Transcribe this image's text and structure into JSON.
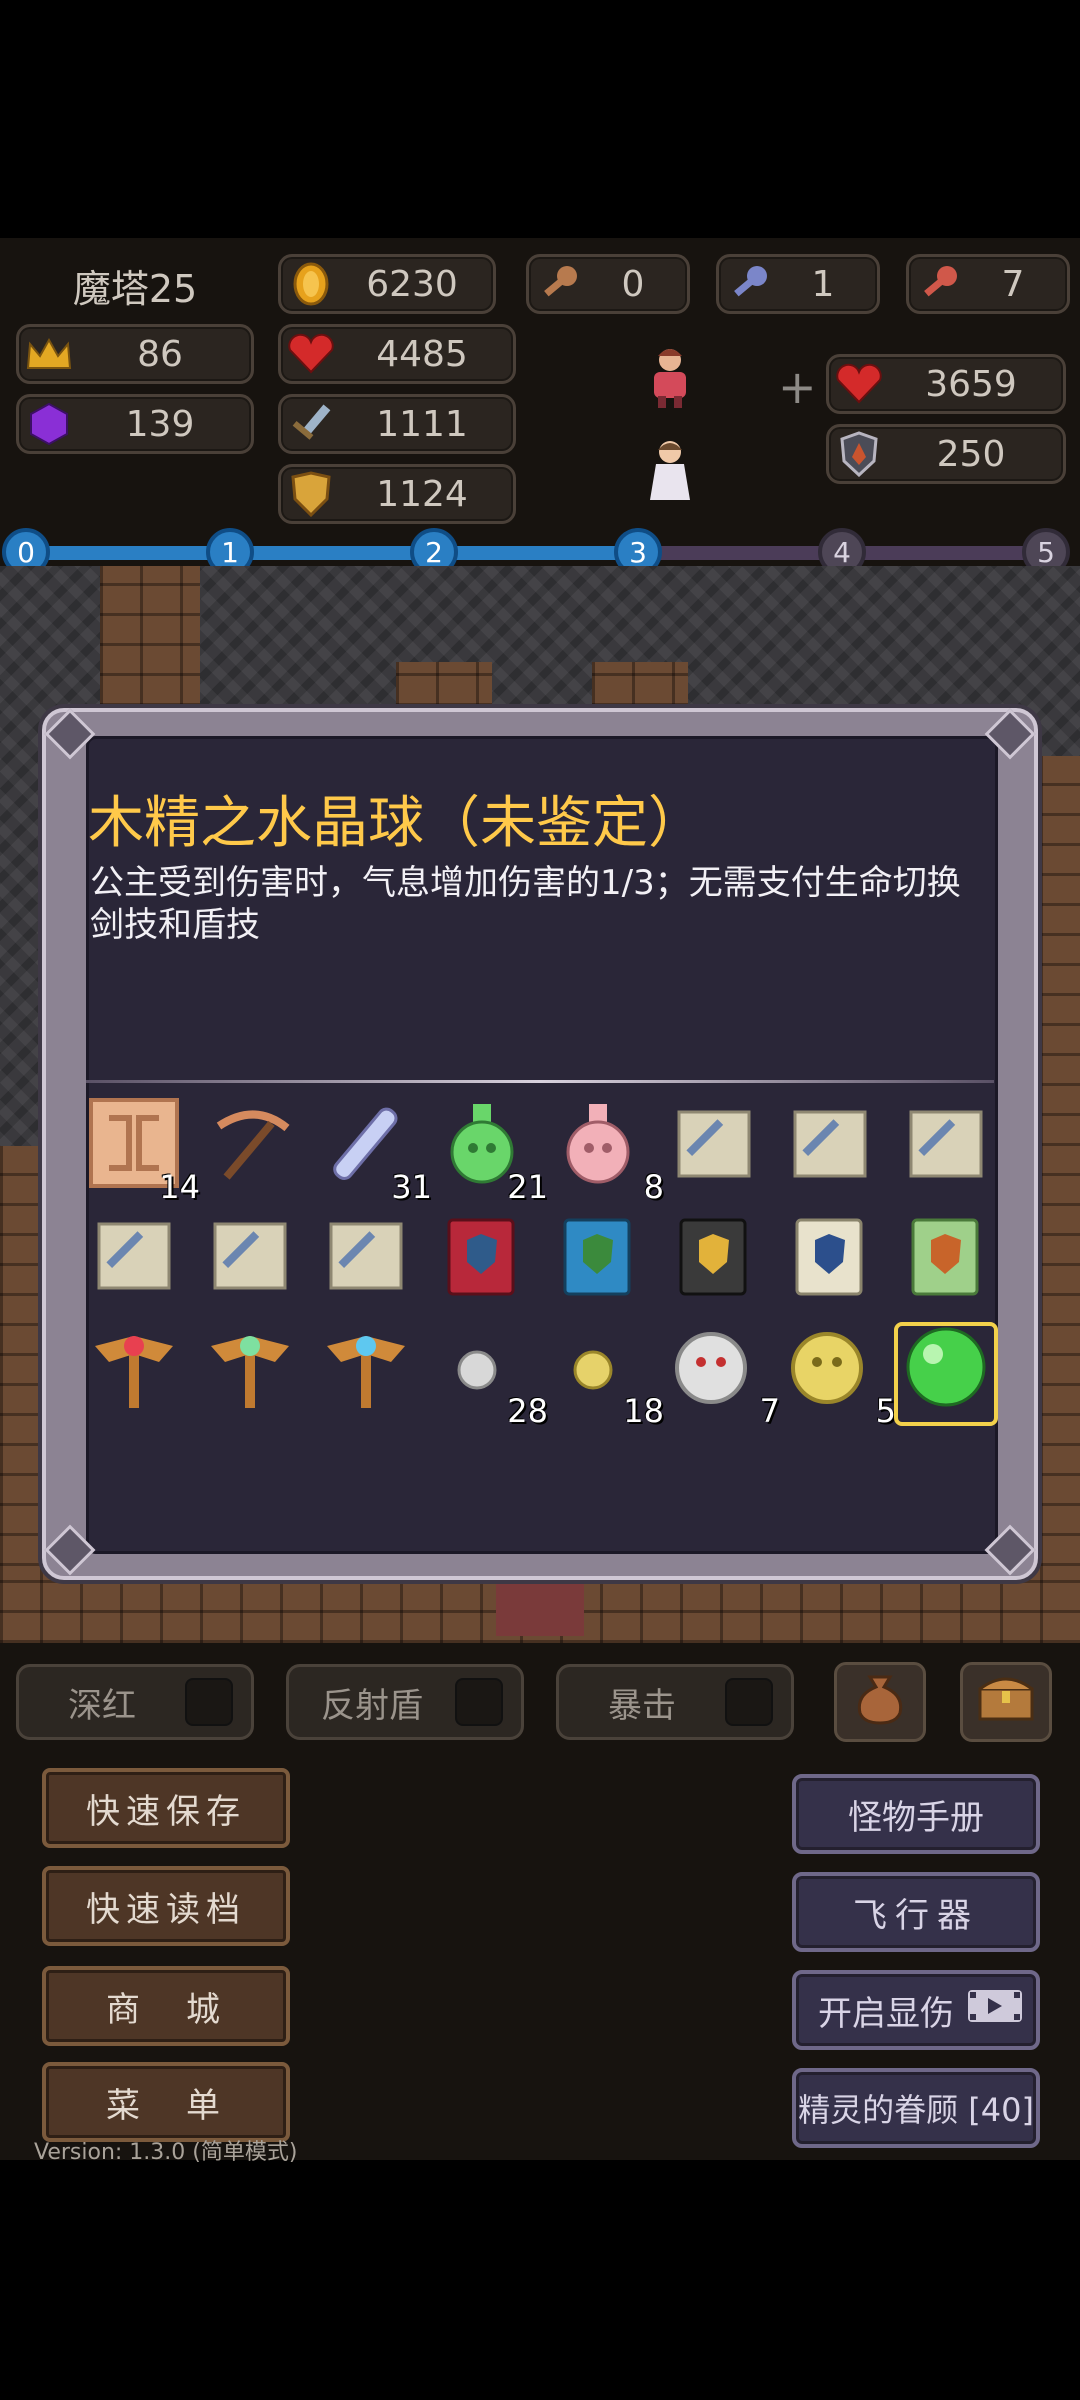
{
  "hud": {
    "floor_label": "魔塔25",
    "gold": "6230",
    "keys": [
      {
        "icon": "yellow-key-icon",
        "value": "0"
      },
      {
        "icon": "blue-key-icon",
        "value": "1"
      },
      {
        "icon": "red-key-icon",
        "value": "7"
      }
    ],
    "level": "86",
    "crystal": "139",
    "hp": "4485",
    "attack": "1111",
    "defense": "1124",
    "ally_hp": "3659",
    "ally_defense": "250",
    "plus": "+"
  },
  "progress": {
    "nodes": [
      "0",
      "1",
      "2",
      "3",
      "4",
      "5"
    ],
    "completed": 3
  },
  "dialog": {
    "title": "木精之水晶球（未鉴定）",
    "description": "公主受到伤害时，气息增加伤害的1/3；无需支付生命切换剑技和盾技",
    "items": [
      {
        "icon": "rune-tile-icon",
        "count": "14"
      },
      {
        "icon": "pickaxe-icon",
        "count": ""
      },
      {
        "icon": "blue-potion-vial-icon",
        "count": "31"
      },
      {
        "icon": "green-flask-icon",
        "count": "21"
      },
      {
        "icon": "pink-flask-icon",
        "count": "8"
      },
      {
        "icon": "sword-scroll-icon",
        "count": ""
      },
      {
        "icon": "sword-scroll-icon",
        "count": ""
      },
      {
        "icon": "sword-scroll-icon",
        "count": ""
      },
      {
        "icon": "sword-scroll-icon",
        "count": ""
      },
      {
        "icon": "sword-scroll-icon",
        "count": ""
      },
      {
        "icon": "sword-scroll-icon",
        "count": ""
      },
      {
        "icon": "red-shield-book-icon",
        "count": ""
      },
      {
        "icon": "green-shield-book-icon",
        "count": ""
      },
      {
        "icon": "gold-shield-book-icon",
        "count": ""
      },
      {
        "icon": "blue-shield-book-icon",
        "count": ""
      },
      {
        "icon": "orange-shield-book-icon",
        "count": ""
      },
      {
        "icon": "red-gem-amulet-icon",
        "count": ""
      },
      {
        "icon": "green-gem-amulet-icon",
        "count": ""
      },
      {
        "icon": "blue-gem-amulet-icon",
        "count": ""
      },
      {
        "icon": "small-silver-coin-icon",
        "count": "28"
      },
      {
        "icon": "small-gold-coin-icon",
        "count": "18"
      },
      {
        "icon": "silver-medal-icon",
        "count": "7"
      },
      {
        "icon": "gold-medal-icon",
        "count": "5"
      },
      {
        "icon": "green-crystal-ball-icon",
        "count": ""
      }
    ]
  },
  "toggles": [
    {
      "label": "深红"
    },
    {
      "label": "反射盾"
    },
    {
      "label": "暴击"
    }
  ],
  "left_buttons": [
    "快速保存",
    "快速读档",
    "商　城",
    "菜　单"
  ],
  "right_buttons": [
    "怪物手册",
    "飞行器",
    "开启显伤",
    "精灵的眷顾 [40]"
  ],
  "version": "Version: 1.3.0 (简单模式)",
  "colors": {
    "title": "#ffc94a",
    "progress_done": "#2a7fc4",
    "selected_border": "#f3d14b"
  }
}
